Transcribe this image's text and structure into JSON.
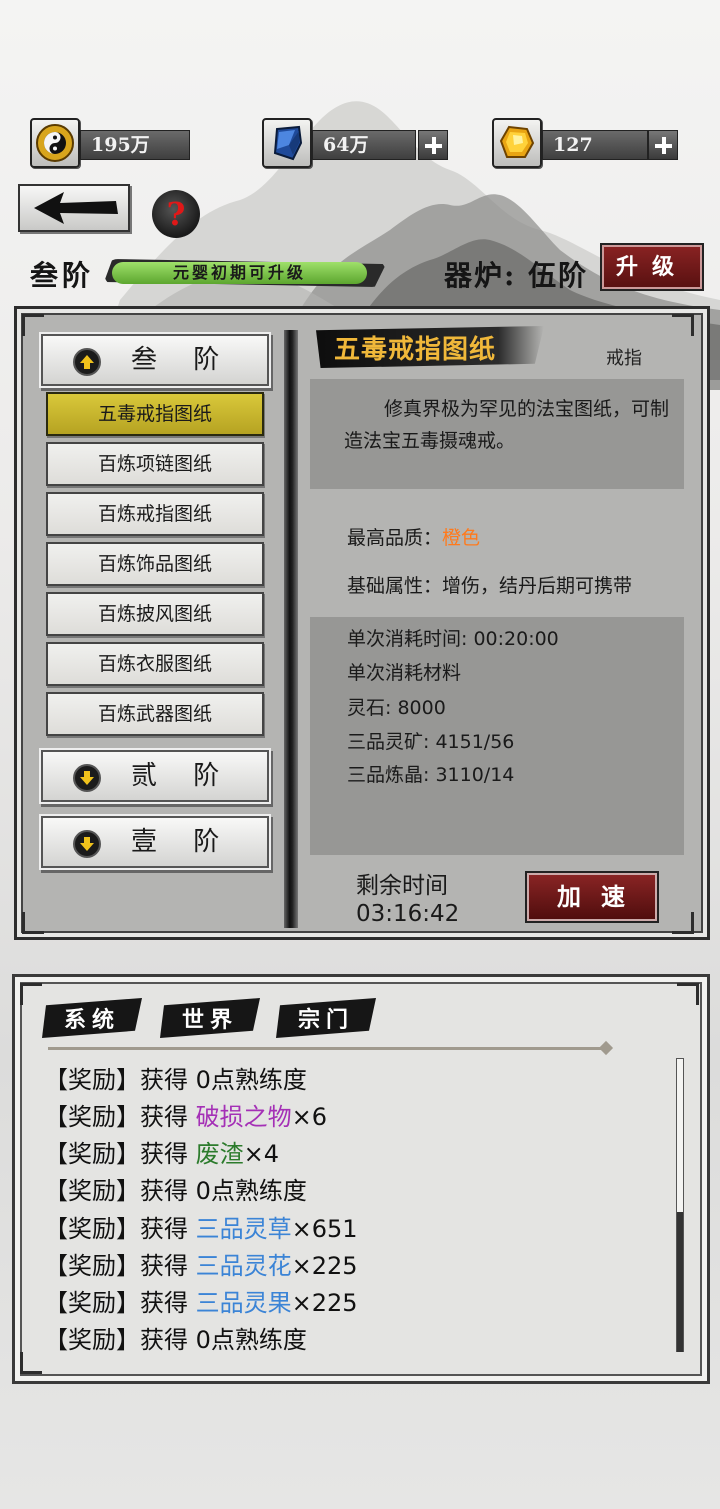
{
  "currencies": [
    {
      "icon": "taiji-coin-icon",
      "value": "195万",
      "has_plus": false
    },
    {
      "icon": "blue-crystal-icon",
      "value": "64万",
      "has_plus": true
    },
    {
      "icon": "gold-gem-icon",
      "value": "127",
      "has_plus": true
    }
  ],
  "header": {
    "help_symbol": "?",
    "tier_label": "叁阶",
    "tier_status": "元婴初期可升级",
    "furnace_label": "器炉: 伍阶",
    "upgrade_label": "升级"
  },
  "tiers": [
    {
      "label": "叁 阶",
      "state": "expanded"
    },
    {
      "label": "贰 阶",
      "state": "collapsed"
    },
    {
      "label": "壹 阶",
      "state": "collapsed"
    }
  ],
  "recipes": [
    {
      "label": "五毒戒指图纸",
      "active": true
    },
    {
      "label": "百炼项链图纸",
      "active": false
    },
    {
      "label": "百炼戒指图纸",
      "active": false
    },
    {
      "label": "百炼饰品图纸",
      "active": false
    },
    {
      "label": "百炼披风图纸",
      "active": false
    },
    {
      "label": "百炼衣服图纸",
      "active": false
    },
    {
      "label": "百炼武器图纸",
      "active": false
    }
  ],
  "detail": {
    "title": "五毒戒指图纸",
    "type": "戒指",
    "description": "修真界极为罕见的法宝图纸，可制造法宝五毒摄魂戒。",
    "quality_label": "最高品质：",
    "quality_value": "橙色",
    "attr_label": "基础属性：增伤，结丹后期可携带",
    "costs": [
      "单次消耗时间: 00:20:00",
      "单次消耗材料",
      "灵石: 8000",
      "三品灵矿: 4151/56",
      "三品炼晶: 3110/14"
    ],
    "remain_label": "剩余时间",
    "remain_time": "03:16:42",
    "speed_label": "加速"
  },
  "chat": {
    "tabs": [
      "系统",
      "世界",
      "宗门"
    ],
    "log": [
      {
        "prefix": "【奖励】获得 ",
        "item": "0点熟练度",
        "color": "",
        "qty": ""
      },
      {
        "prefix": "【奖励】获得 ",
        "item": "破损之物",
        "color": "purple",
        "qty": "×6"
      },
      {
        "prefix": "【奖励】获得 ",
        "item": "废渣",
        "color": "green",
        "qty": "×4"
      },
      {
        "prefix": "【奖励】获得 ",
        "item": "0点熟练度",
        "color": "",
        "qty": ""
      },
      {
        "prefix": "【奖励】获得 ",
        "item": "三品灵草",
        "color": "blue",
        "qty": "×651"
      },
      {
        "prefix": "【奖励】获得 ",
        "item": "三品灵花",
        "color": "blue",
        "qty": "×225"
      },
      {
        "prefix": "【奖励】获得 ",
        "item": "三品灵果",
        "color": "blue",
        "qty": "×225"
      },
      {
        "prefix": "【奖励】获得 ",
        "item": "0点熟练度",
        "color": "",
        "qty": ""
      }
    ]
  },
  "colors": {
    "accent_red": "#7a1a1a",
    "quality_orange": "#ff7a1c",
    "active_recipe": "#c9b52c"
  }
}
